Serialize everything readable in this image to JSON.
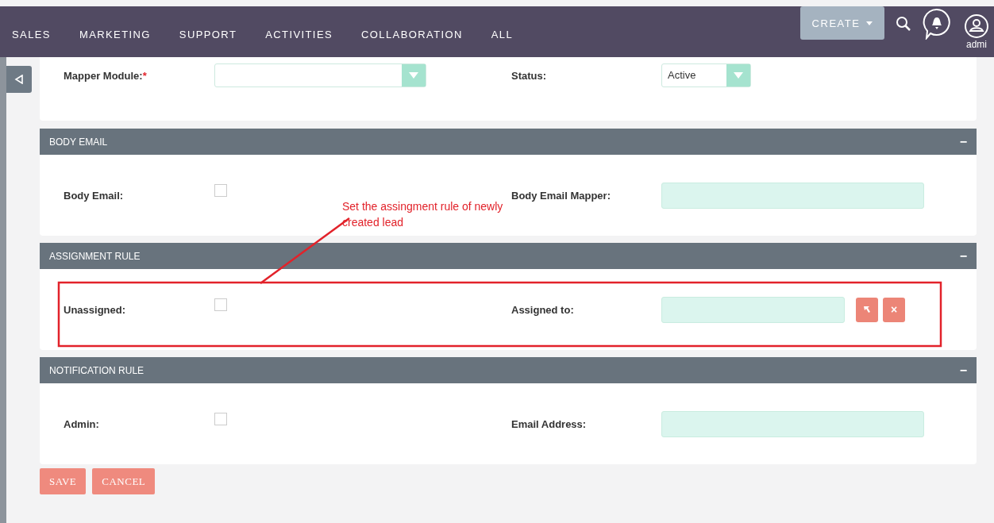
{
  "nav": {
    "items": [
      "SALES",
      "MARKETING",
      "SUPPORT",
      "ACTIVITIES",
      "COLLABORATION",
      "ALL"
    ],
    "create": "CREATE",
    "user": "admi"
  },
  "top_panel": {
    "fields": [
      {
        "label": "Mapper Module:",
        "required_mark": "*",
        "kind": "select"
      },
      {
        "label": "Status:",
        "kind": "select",
        "value": "Active"
      }
    ]
  },
  "sections": [
    {
      "title": "BODY EMAIL",
      "collapse": "−",
      "fields": [
        {
          "label": "Body Email:",
          "kind": "checkbox",
          "checked": false
        },
        {
          "label": "Body Email Mapper:",
          "kind": "text"
        }
      ]
    },
    {
      "title": "ASSIGNMENT RULE",
      "collapse": "−",
      "fields": [
        {
          "label": "Unassigned:",
          "kind": "checkbox",
          "checked": false
        },
        {
          "label": "Assigned to:",
          "kind": "relate",
          "clear": "×"
        }
      ]
    },
    {
      "title": "NOTIFICATION RULE",
      "collapse": "−",
      "fields": [
        {
          "label": "Admin:",
          "kind": "checkbox",
          "checked": false
        },
        {
          "label": "Email Address:",
          "kind": "text"
        }
      ]
    }
  ],
  "annotation": {
    "text": "Set the assingment rule of newly created lead"
  },
  "buttons": [
    "SAVE",
    "CANCEL"
  ]
}
